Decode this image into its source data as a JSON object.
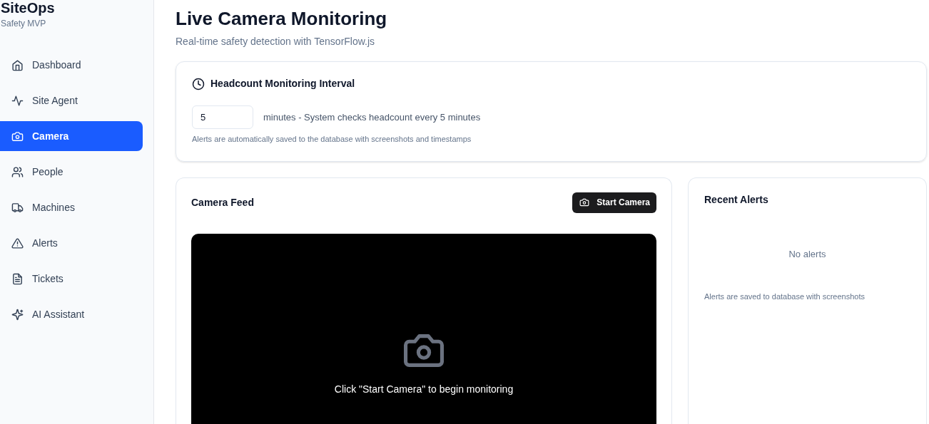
{
  "brand": {
    "name": "SiteOps",
    "subtitle": "Safety MVP"
  },
  "nav": [
    {
      "label": "Dashboard",
      "selected": false
    },
    {
      "label": "Site Agent",
      "selected": false
    },
    {
      "label": "Camera",
      "selected": true
    },
    {
      "label": "People",
      "selected": false
    },
    {
      "label": "Machines",
      "selected": false
    },
    {
      "label": "Alerts",
      "selected": false
    },
    {
      "label": "Tickets",
      "selected": false
    },
    {
      "label": "AI Assistant",
      "selected": false
    }
  ],
  "page": {
    "title": "Live Camera Monitoring",
    "subtitle": "Real-time safety detection with TensorFlow.js"
  },
  "interval": {
    "title": "Headcount Monitoring Interval",
    "value": "5",
    "description": "minutes - System checks headcount every 5 minutes",
    "note": "Alerts are automatically saved to the database with screenshots and timestamps"
  },
  "camera_feed": {
    "title": "Camera Feed",
    "button": "Start Camera",
    "message": "Click \"Start Camera\" to begin monitoring"
  },
  "recent_alerts": {
    "title": "Recent Alerts",
    "empty": "No alerts",
    "note": "Alerts are saved to database with screenshots"
  }
}
